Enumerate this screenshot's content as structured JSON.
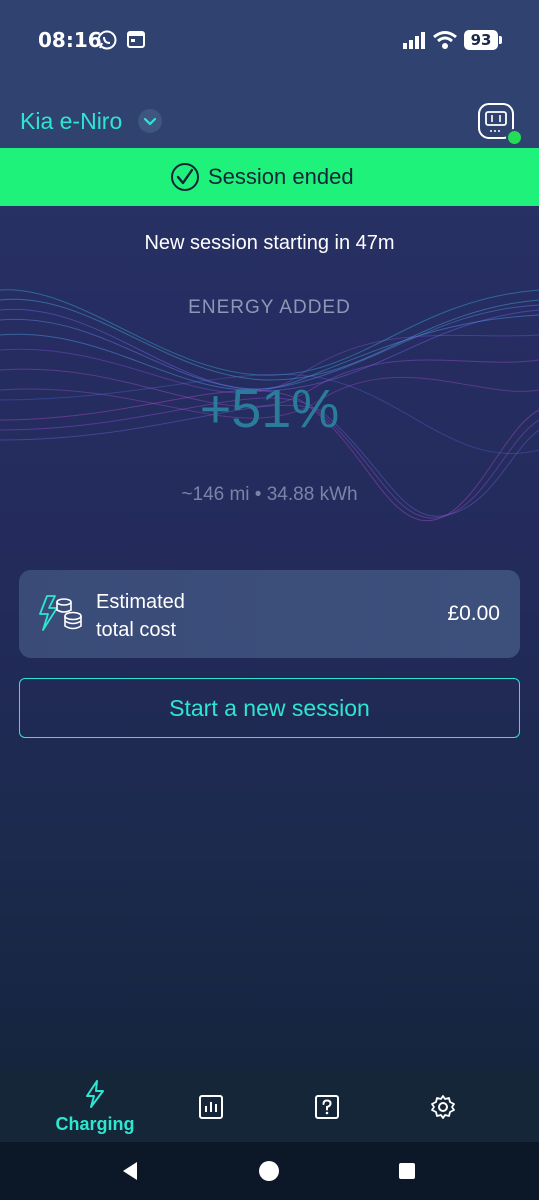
{
  "status_bar": {
    "time": "08:16",
    "battery": "93"
  },
  "header": {
    "vehicle_name": "Kia e-Niro"
  },
  "banner": {
    "text": "Session ended",
    "color": "#1ff27a"
  },
  "session": {
    "note": "New session starting in 47m",
    "energy_label": "ENERGY ADDED",
    "energy_value": "+51%",
    "energy_detail": "~146 mi • 34.88 kWh"
  },
  "cost": {
    "label": "Estimated\ntotal cost",
    "value": "£0.00"
  },
  "actions": {
    "start_label": "Start a new session"
  },
  "nav": {
    "items": [
      {
        "label": "Charging",
        "icon": "lightning-icon",
        "active": true
      },
      {
        "label": "",
        "icon": "stats-icon",
        "active": false
      },
      {
        "label": "",
        "icon": "help-icon",
        "active": false
      },
      {
        "label": "",
        "icon": "gear-icon",
        "active": false
      }
    ]
  },
  "colors": {
    "accent": "#2ee6d0",
    "success": "#1ff27a",
    "background": "#242b5c"
  }
}
